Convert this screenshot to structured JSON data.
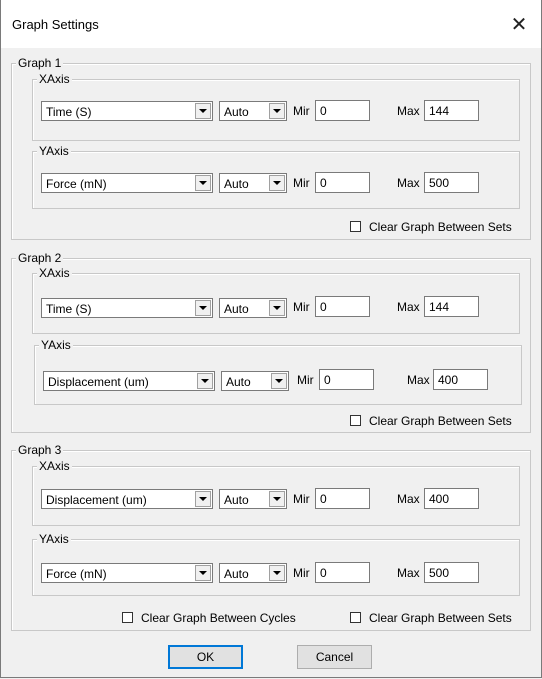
{
  "window": {
    "title": "Graph Settings",
    "close_glyph": "✕"
  },
  "graphs": [
    {
      "legend": "Graph 1",
      "x": {
        "legend": "XAxis",
        "variable": "Time (S)",
        "mode": "Auto",
        "min_label": "Mir",
        "min": "0",
        "max_label": "Max",
        "max": "144"
      },
      "y": {
        "legend": "YAxis",
        "variable": "Force (mN)",
        "mode": "Auto",
        "min_label": "Mir",
        "min": "0",
        "max_label": "Max",
        "max": "500"
      },
      "clear_sets": "Clear Graph Between Sets"
    },
    {
      "legend": "Graph 2",
      "x": {
        "legend": "XAxis",
        "variable": "Time (S)",
        "mode": "Auto",
        "min_label": "Mir",
        "min": "0",
        "max_label": "Max",
        "max": "144"
      },
      "y": {
        "legend": "YAxis",
        "variable": "Displacement (um)",
        "mode": "Auto",
        "min_label": "Mir",
        "min": "0",
        "max_label": "Max",
        "max": "400"
      },
      "clear_sets": "Clear Graph Between Sets"
    },
    {
      "legend": "Graph 3",
      "x": {
        "legend": "XAxis",
        "variable": "Displacement (um)",
        "mode": "Auto",
        "min_label": "Mir",
        "min": "0",
        "max_label": "Max",
        "max": "400"
      },
      "y": {
        "legend": "YAxis",
        "variable": "Force (mN)",
        "mode": "Auto",
        "min_label": "Mir",
        "min": "0",
        "max_label": "Max",
        "max": "500"
      },
      "clear_cycles": "Clear Graph Between Cycles",
      "clear_sets": "Clear Graph Between Sets"
    }
  ],
  "buttons": {
    "ok": "OK",
    "cancel": "Cancel"
  }
}
